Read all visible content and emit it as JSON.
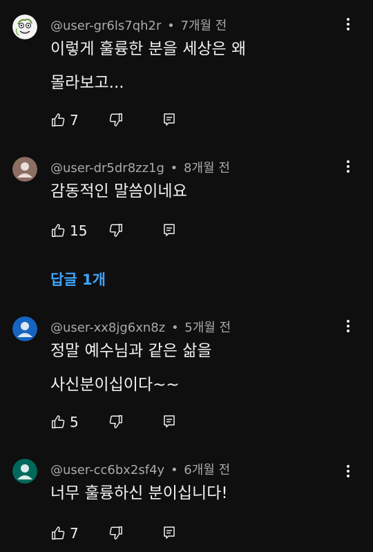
{
  "comments": [
    {
      "author": "@user-gr6ls7qh2r",
      "separator": "•",
      "time": "7개월 전",
      "text": "이렇게 훌륭한 분을 세상은 왜 몰라보고...",
      "likes": "7",
      "avatar_icon": "cartoon-face-icon"
    },
    {
      "author": "@user-dr5dr8zz1g",
      "separator": "•",
      "time": "8개월 전",
      "text": "감동적인 말씀이네요",
      "likes": "15",
      "replies_label": "답글 1개",
      "avatar_icon": "default-person-icon",
      "avatar_color": "#8d6e63"
    },
    {
      "author": "@user-xx8jg6xn8z",
      "separator": "•",
      "time": "5개월 전",
      "text": "정말 예수님과 같은 삶을 사신분이십이다~~",
      "likes": "5",
      "avatar_icon": "default-person-icon",
      "avatar_color": "#1565c0"
    },
    {
      "author": "@user-cc6bx2sf4y",
      "separator": "•",
      "time": "6개월 전",
      "text": "너무 훌륭하신 분이십니다!",
      "likes": "7",
      "avatar_icon": "default-person-icon",
      "avatar_color": "#00695c"
    }
  ],
  "colors": {
    "background": "#0f0f0f",
    "text": "#f1f1f1",
    "meta": "#aaaaaa",
    "link": "#3ea6ff"
  }
}
